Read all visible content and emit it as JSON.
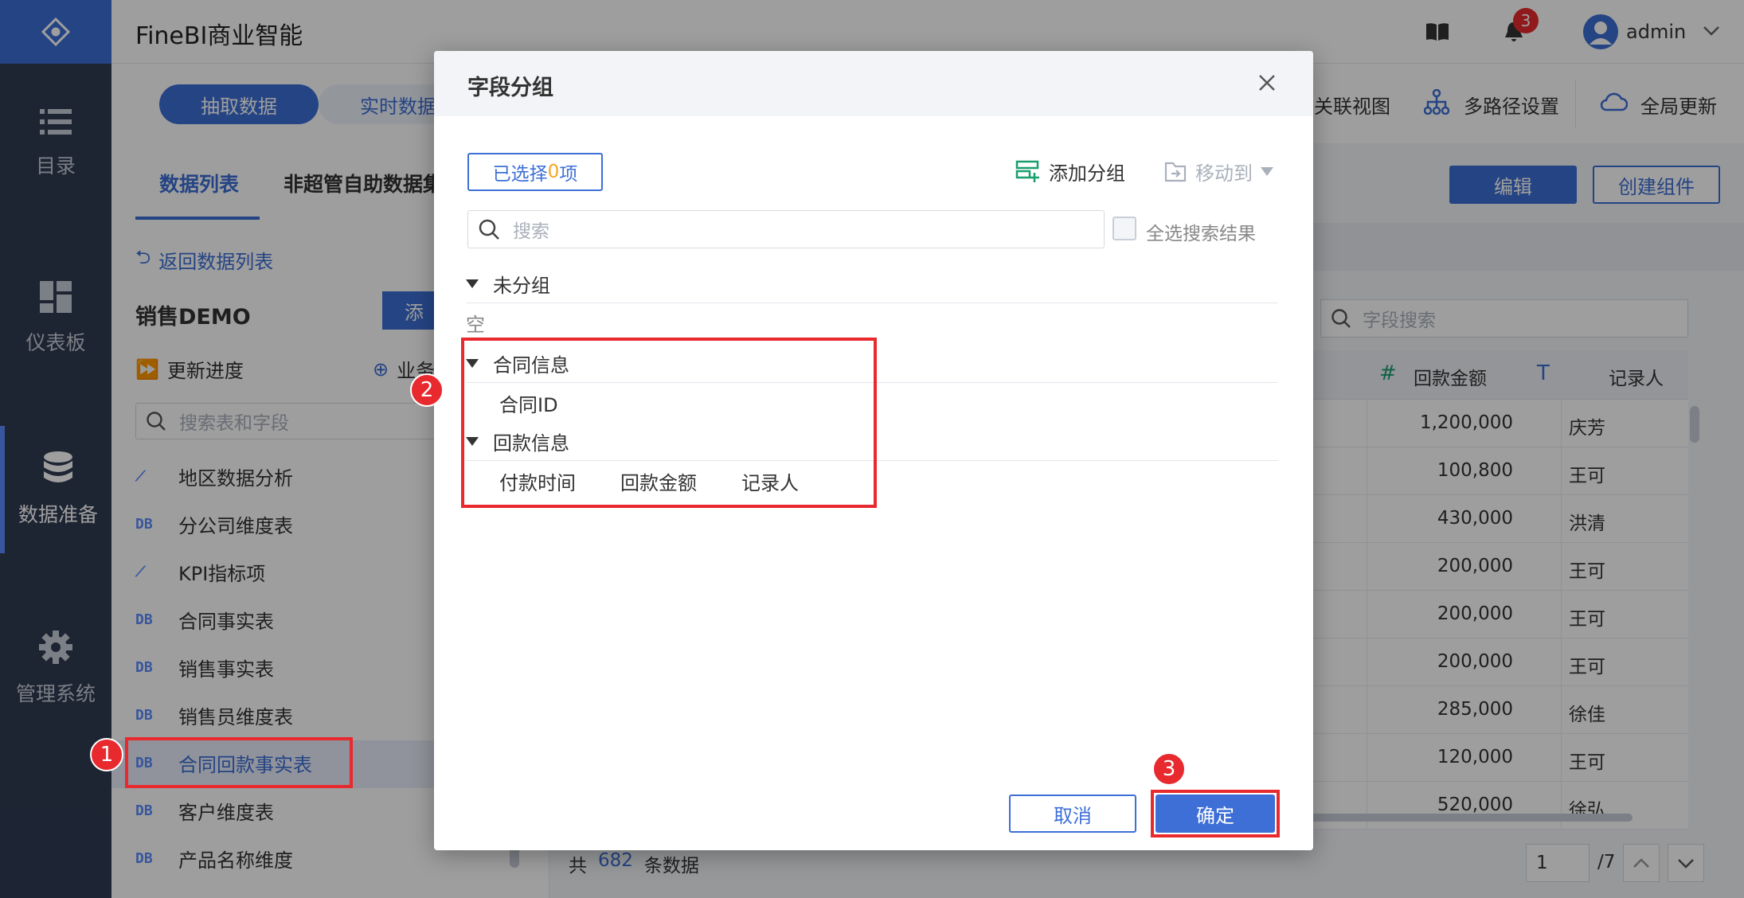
{
  "app": {
    "title": "FineBI商业智能",
    "user": "admin",
    "notification_count": "3",
    "accent": "#3d6fd6"
  },
  "nav": [
    {
      "label": "目录",
      "icon": "list-icon"
    },
    {
      "label": "仪表板",
      "icon": "dashboard-icon"
    },
    {
      "label": "数据准备",
      "icon": "database-icon"
    },
    {
      "label": "管理系统",
      "icon": "gear-icon"
    }
  ],
  "toolbar": {
    "mode_extract": "抽取数据",
    "mode_realtime": "实时数据",
    "relation_view": "关联视图",
    "multipath": "多路径设置",
    "global_update": "全局更新"
  },
  "left": {
    "tab_data_list": "数据列表",
    "tab_self_service": "非超管自助数据集",
    "back_link": "返回数据列表",
    "package_name": "销售DEMO",
    "add_btn": "添",
    "update_progress": "更新进度",
    "business": "业务",
    "search_placeholder": "搜索表和字段",
    "tables": [
      {
        "label": "地区数据分析",
        "type": "analysis"
      },
      {
        "label": "分公司维度表",
        "type": "db"
      },
      {
        "label": "KPI指标项",
        "type": "analysis"
      },
      {
        "label": "合同事实表",
        "type": "db"
      },
      {
        "label": "销售事实表",
        "type": "db"
      },
      {
        "label": "销售员维度表",
        "type": "db"
      },
      {
        "label": "合同回款事实表",
        "type": "db"
      },
      {
        "label": "客户维度表",
        "type": "db"
      },
      {
        "label": "产品名称维度",
        "type": "db"
      }
    ],
    "db_tag": "DB"
  },
  "right": {
    "edit_btn": "编辑",
    "create_component_btn": "创建组件",
    "field_search_placeholder": "字段搜索",
    "col_amount": "回款金额",
    "col_recorder": "记录人",
    "col_amount_type": "#",
    "col_recorder_type": "T",
    "rows": [
      {
        "amount": "1,200,000",
        "recorder": "庆芳"
      },
      {
        "amount": "100,800",
        "recorder": "王可"
      },
      {
        "amount": "430,000",
        "recorder": "洪清"
      },
      {
        "amount": "200,000",
        "recorder": "王可"
      },
      {
        "amount": "200,000",
        "recorder": "王可"
      },
      {
        "amount": "200,000",
        "recorder": "王可"
      },
      {
        "amount": "285,000",
        "recorder": "徐佳"
      },
      {
        "amount": "120,000",
        "recorder": "王可"
      },
      {
        "amount": "520,000",
        "recorder": "徐弘"
      }
    ],
    "footer_prefix": "共",
    "footer_count": "682",
    "footer_suffix": "条数据",
    "page_current": "1",
    "page_total": "/7"
  },
  "dialog": {
    "title": "字段分组",
    "selected_prefix": "已选择",
    "selected_count": "0",
    "selected_suffix": "项",
    "add_group": "添加分组",
    "move_to": "移动到",
    "search_placeholder": "搜索",
    "select_all_results": "全选搜索结果",
    "ungrouped": "未分组",
    "empty": "空",
    "group1": "合同信息",
    "group1_fields": [
      "合同ID"
    ],
    "group2": "回款信息",
    "group2_fields": [
      "付款时间",
      "回款金额",
      "记录人"
    ],
    "cancel": "取消",
    "confirm": "确定"
  },
  "annotations": [
    "1",
    "2",
    "3"
  ]
}
